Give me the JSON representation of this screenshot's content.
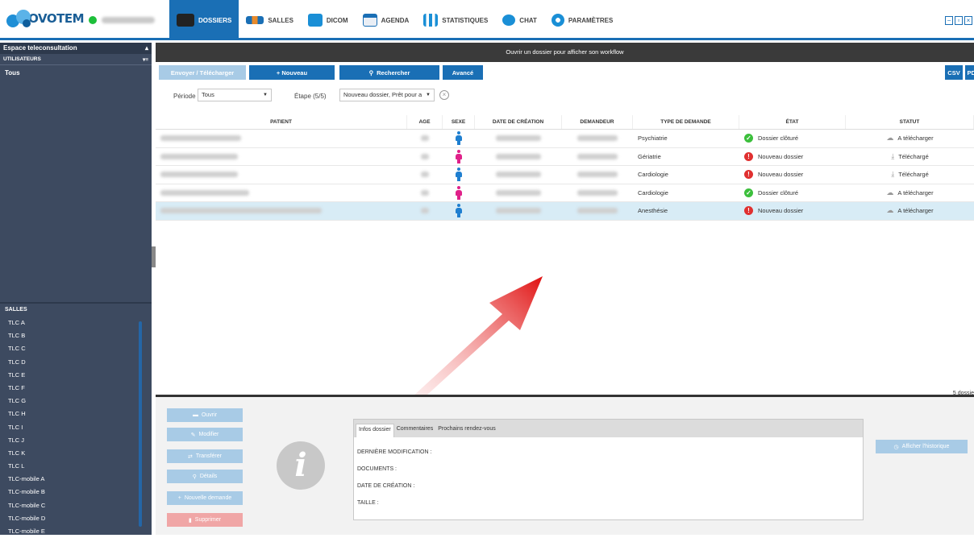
{
  "header": {
    "logo_text": "COVOTEM",
    "nav": [
      {
        "label": "DOSSIERS",
        "icon": "folder-icon",
        "active": true
      },
      {
        "label": "SALLES",
        "icon": "people-icon",
        "active": false
      },
      {
        "label": "DICOM",
        "icon": "dicom-icon",
        "active": false
      },
      {
        "label": "AGENDA",
        "icon": "calendar-icon",
        "active": false
      },
      {
        "label": "STATISTIQUES",
        "icon": "bar-chart-icon",
        "active": false
      },
      {
        "label": "CHAT",
        "icon": "chat-bubble-icon",
        "active": false
      },
      {
        "label": "PARAMÈTRES",
        "icon": "gears-icon",
        "active": false
      }
    ],
    "status_color": "#1dbf3a",
    "accent_color": "#1a6fb5"
  },
  "sidebar": {
    "title": "Espace teleconsultation",
    "users_header": "UTILISATEURS",
    "users_filter": "Tous",
    "salles_header": "SALLES",
    "salles": [
      "TLC A",
      "TLC B",
      "TLC C",
      "TLC D",
      "TLC E",
      "TLC F",
      "TLC G",
      "TLC H",
      "TLC I",
      "TLC J",
      "TLC K",
      "TLC L",
      "TLC-mobile A",
      "TLC-mobile B",
      "TLC-mobile C",
      "TLC-mobile D",
      "TLC-mobile E"
    ]
  },
  "main": {
    "banner": "Ouvrir un dossier pour afficher son workflow",
    "toolbar": {
      "envoyer": "Envoyer / Télécharger",
      "nouveau": "+ Nouveau",
      "rechercher": "Rechercher",
      "avance": "Avancé",
      "csv": "CSV",
      "pdf": "PDF"
    },
    "filters": {
      "periode_label": "Période",
      "periode_value": "Tous",
      "etape_label": "Étape (5/5)",
      "etape_value": "Nouveau dossier, Prêt pour a"
    },
    "columns": [
      "PATIENT",
      "AGE",
      "SEXE",
      "DATE DE CRÉATION",
      "DEMANDEUR",
      "TYPE DE DEMANDE",
      "ÉTAT",
      "STATUT"
    ],
    "rows": [
      {
        "sexe": "M",
        "type": "Psychiatrie",
        "etat": "Dossier clôturé",
        "etat_kind": "ok",
        "statut": "A télécharger",
        "selected": false
      },
      {
        "sexe": "F",
        "type": "Gériatrie",
        "etat": "Nouveau dossier",
        "etat_kind": "new",
        "statut": "Téléchargé",
        "selected": false
      },
      {
        "sexe": "M",
        "type": "Cardiologie",
        "etat": "Nouveau dossier",
        "etat_kind": "new",
        "statut": "Téléchargé",
        "selected": false
      },
      {
        "sexe": "F",
        "type": "Cardiologie",
        "etat": "Dossier clôturé",
        "etat_kind": "ok",
        "statut": "A télécharger",
        "selected": false
      },
      {
        "sexe": "M",
        "type": "Anesthésie",
        "etat": "Nouveau dossier",
        "etat_kind": "new",
        "statut": "A télécharger",
        "selected": true
      }
    ],
    "count_label": "5 dossie",
    "colors": {
      "male": "#1f7fd0",
      "female": "#e0218a",
      "ok": "#3cbf3c",
      "new": "#e03030",
      "selected_row": "#d8ecf6"
    }
  },
  "details": {
    "actions": [
      "Ouvrir",
      "Modifier",
      "Transférer",
      "Détails",
      "Nouvelle demande",
      "Supprimer"
    ],
    "tabs": [
      "Infos dossier",
      "Commentaires",
      "Prochains rendez-vous"
    ],
    "fields": [
      "DERNIÈRE MODIFICATION :",
      "DOCUMENTS :",
      "DATE DE CRÉATION :",
      "TAILLE :"
    ],
    "history_button": "Afficher l'historique"
  }
}
